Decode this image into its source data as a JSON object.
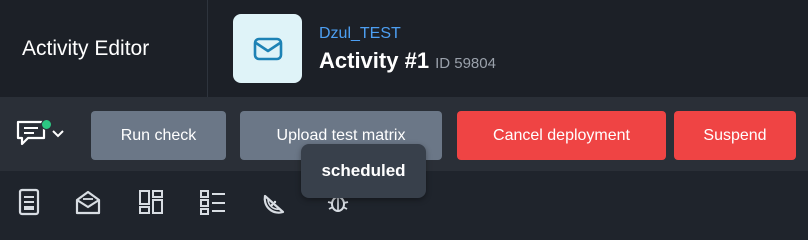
{
  "header": {
    "app_title": "Activity Editor",
    "project_link": "Dzul_TEST",
    "activity_name": "Activity #1",
    "activity_id": "ID 59804",
    "activity_icon": "envelope-icon"
  },
  "actions": {
    "comment_icon": "comment-icon",
    "comment_badge_color": "#2cc782",
    "run_check": "Run check",
    "upload_matrix": "Upload test matrix",
    "cancel_deployment": "Cancel deployment",
    "suspend": "Suspend"
  },
  "toolbar": {
    "icons": [
      "document-icon",
      "mail-open-icon",
      "layout-icon",
      "list-icon",
      "melon-icon",
      "bug-icon"
    ]
  },
  "tooltip": {
    "text": "scheduled"
  },
  "colors": {
    "accent_blue": "#4d9ff2",
    "button_gray": "#6b7787",
    "button_red": "#ef4444"
  }
}
